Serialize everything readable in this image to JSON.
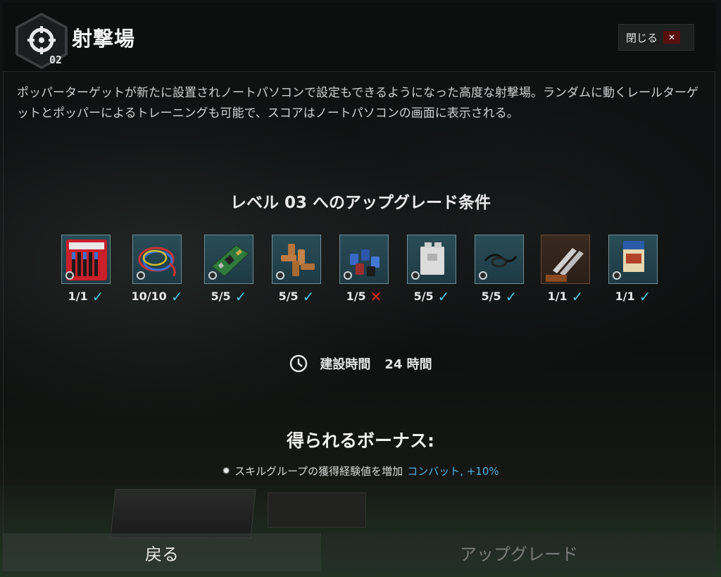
{
  "header": {
    "title": "射撃場",
    "level": "02",
    "close_label": "閉じる",
    "close_icon": "✕"
  },
  "description": "ポッパーターゲットが新たに設置されノートパソコンで設定もできるようになった高度な射撃場。ランダムに動くレールターゲットとポッパーによるトレーニングも可能で、スコアはノートパソコンの画面に表示される。",
  "requirements": {
    "title": "レベル 03 へのアップグレード条件",
    "items": [
      {
        "icon": "screwdriver-set-icon",
        "qty": "1/1",
        "status": "check"
      },
      {
        "icon": "wires-icon",
        "qty": "10/10",
        "status": "check"
      },
      {
        "icon": "circuit-board-icon",
        "qty": "5/5",
        "status": "check"
      },
      {
        "icon": "copper-fittings-icon",
        "qty": "5/5",
        "status": "check"
      },
      {
        "icon": "capacitors-icon",
        "qty": "1/5",
        "status": "cross"
      },
      {
        "icon": "relay-icon",
        "qty": "5/5",
        "status": "check"
      },
      {
        "icon": "cable-icon",
        "qty": "5/5",
        "status": "check"
      },
      {
        "icon": "multitool-icon",
        "qty": "1/1",
        "status": "check"
      },
      {
        "icon": "book-icon",
        "qty": "1/1",
        "status": "check"
      }
    ]
  },
  "build": {
    "label": "建設時間",
    "value": "24 時間"
  },
  "bonus": {
    "title": "得られるボーナス:",
    "text": "スキルグループの獲得経験値を増加",
    "highlight": "コンバット, +10%"
  },
  "footer": {
    "back_label": "戻る",
    "upgrade_label": "アップグレード"
  },
  "colors": {
    "accent": "#4fc4e3",
    "error": "#e02a2a",
    "slot": "#294d58"
  }
}
